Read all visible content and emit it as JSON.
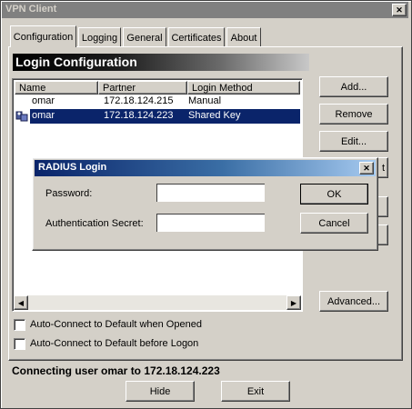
{
  "window": {
    "title": "VPN Client",
    "close_glyph": "✕"
  },
  "tabs": [
    {
      "label": "Configuration",
      "active": true
    },
    {
      "label": "Logging"
    },
    {
      "label": "General"
    },
    {
      "label": "Certificates"
    },
    {
      "label": "About"
    }
  ],
  "section_title": "Login Configuration",
  "table": {
    "headers": {
      "name": "Name",
      "partner": "Partner",
      "method": "Login Method"
    },
    "rows": [
      {
        "name": "omar",
        "partner": "172.18.124.215",
        "method": "Manual",
        "selected": false,
        "icon": ""
      },
      {
        "name": "omar",
        "partner": "172.18.124.223",
        "method": "Shared Key",
        "selected": true,
        "icon": "connection-icon"
      }
    ]
  },
  "side_buttons": {
    "add": "Add...",
    "remove": "Remove",
    "edit": "Edit...",
    "advanced": "Advanced..."
  },
  "hidden_button_fragment": "t",
  "checkboxes": {
    "opened": "Auto-Connect to Default when Opened",
    "logon": "Auto-Connect to Default before Logon"
  },
  "status": "Connecting user omar to 172.18.124.223",
  "bottom_buttons": {
    "hide": "Hide",
    "exit": "Exit"
  },
  "dialog": {
    "title": "RADIUS Login",
    "close_glyph": "✕",
    "password_label": "Password:",
    "password_value": "",
    "secret_label": "Authentication Secret:",
    "secret_value": "",
    "ok": "OK",
    "cancel": "Cancel"
  },
  "colors": {
    "selection": "#0a246a",
    "face": "#d4d0c8",
    "title_gradient_start": "#0a246a",
    "title_gradient_end": "#a6caf0"
  }
}
